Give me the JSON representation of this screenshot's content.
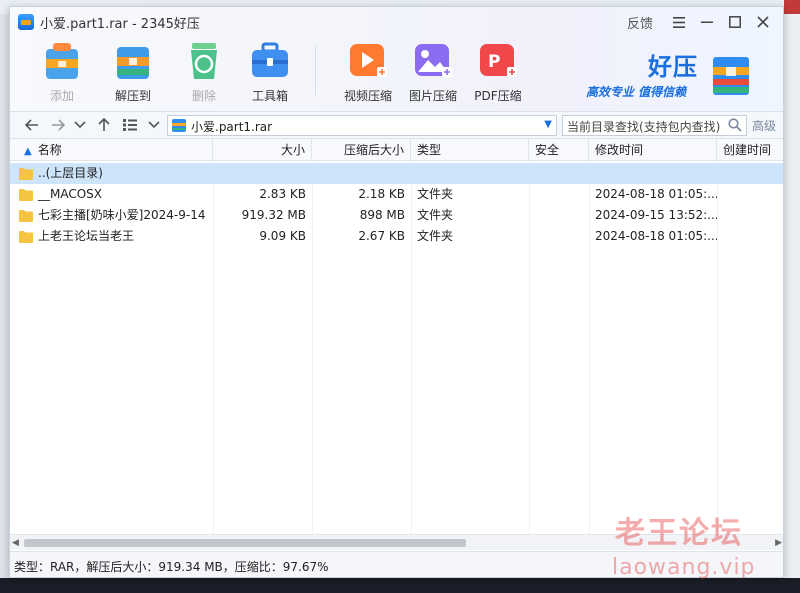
{
  "window": {
    "title": "小爱.part1.rar - 2345好压",
    "feedback_label": "反馈",
    "menu_icon": "menu-icon",
    "minimize_icon": "minimize-icon",
    "maximize_icon": "maximize-icon",
    "close_icon": "close-icon"
  },
  "toolbar": {
    "buttons": [
      {
        "label": "添加",
        "icon": "add-icon",
        "enabled": false
      },
      {
        "label": "解压到",
        "icon": "extract-icon",
        "enabled": true
      },
      {
        "label": "删除",
        "icon": "delete-icon",
        "enabled": false
      },
      {
        "label": "工具箱",
        "icon": "toolbox-icon",
        "enabled": true
      },
      {
        "label": "视频压缩",
        "icon": "video-compress-icon",
        "enabled": true
      },
      {
        "label": "图片压缩",
        "icon": "image-compress-icon",
        "enabled": true
      },
      {
        "label": "PDF压缩",
        "icon": "pdf-compress-icon",
        "enabled": true
      }
    ]
  },
  "brand": {
    "name": "好压",
    "slogan": "高效专业  值得信赖"
  },
  "addressbar": {
    "path": "小爱.part1.rar",
    "search_placeholder": "当前目录查找(支持包内查找)",
    "advanced_label": "高级"
  },
  "table": {
    "columns": [
      "名称",
      "大小",
      "压缩后大小",
      "类型",
      "安全",
      "修改时间",
      "创建时间"
    ],
    "rows": [
      {
        "name": "..(上层目录)",
        "size": "",
        "packed": "",
        "type": "",
        "security": "",
        "modified": "",
        "created": "",
        "selected": true
      },
      {
        "name": "__MACOSX",
        "size": "2.83 KB",
        "packed": "2.18 KB",
        "type": "文件夹",
        "security": "",
        "modified": "2024-08-18 01:05:...",
        "created": ""
      },
      {
        "name": "七彩主播[奶味小爱]2024-9-14",
        "size": "919.32 MB",
        "packed": "898 MB",
        "type": "文件夹",
        "security": "",
        "modified": "2024-09-15 13:52:...",
        "created": ""
      },
      {
        "name": "上老王论坛当老王",
        "size": "9.09 KB",
        "packed": "2.67 KB",
        "type": "文件夹",
        "security": "",
        "modified": "2024-08-18 01:05:...",
        "created": ""
      }
    ]
  },
  "statusbar": {
    "text": "类型：RAR，解压后大小：919.34 MB，压缩比：97.67%"
  },
  "watermark": {
    "line1": "老王论坛",
    "line2": "laowang.vip"
  },
  "colors": {
    "accent": "#1a6fe0",
    "selection": "#cde4fb",
    "folder": "#f5c542"
  }
}
